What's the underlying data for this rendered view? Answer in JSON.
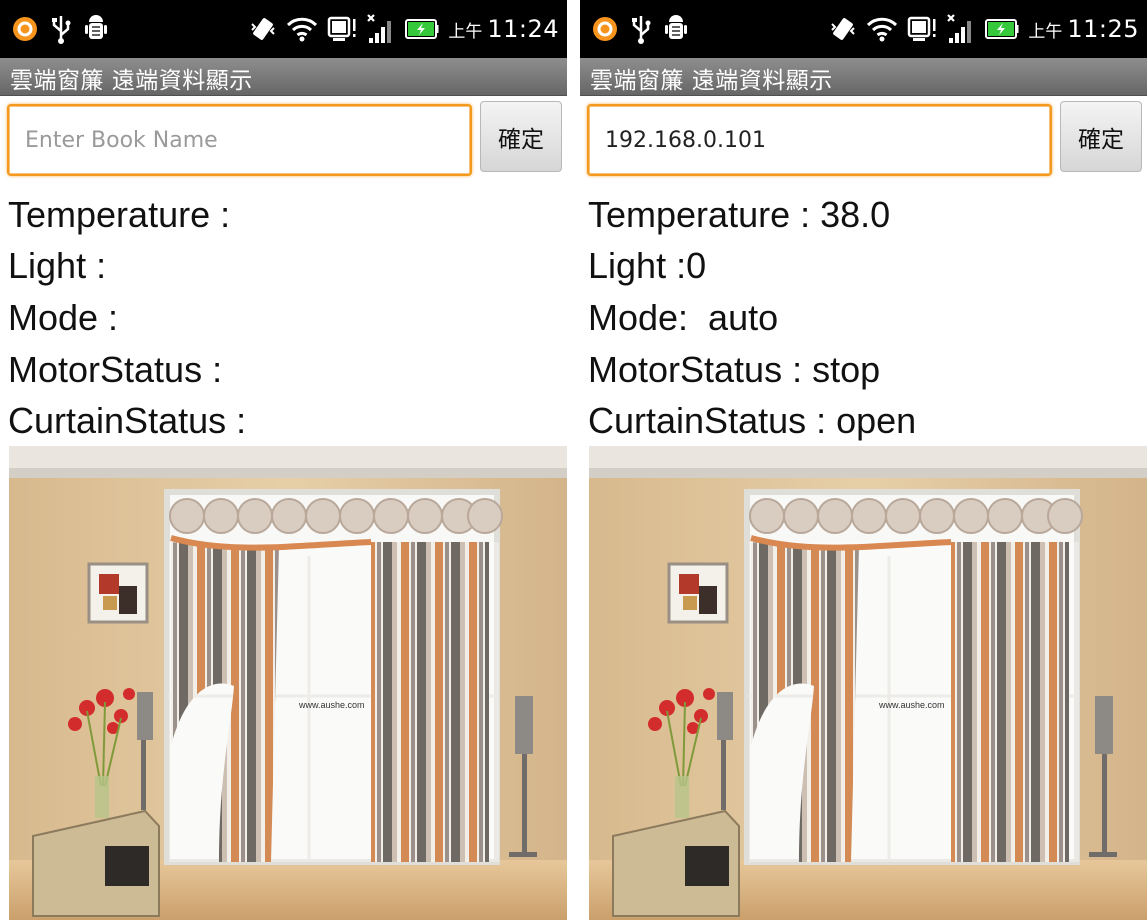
{
  "screens": [
    {
      "status_bar": {
        "ampm": "上午",
        "time": "11:24",
        "icons": [
          "orange-app-icon",
          "usb-icon",
          "android-debug-icon",
          "vibrate-icon",
          "wifi-icon",
          "sim-card-icon",
          "signal-icon",
          "battery-charging-icon"
        ]
      },
      "title": "雲端窗簾 遠端資料顯示",
      "input": {
        "value": "",
        "placeholder": "Enter Book Name"
      },
      "button_label": "確定",
      "info": {
        "temperature": "Temperature :",
        "light": "Light :",
        "mode": "Mode :",
        "motor_status": "MotorStatus :",
        "curtain_status": "CurtainStatus :"
      },
      "picture": {
        "watermark": "www.aushe.com"
      }
    },
    {
      "status_bar": {
        "ampm": "上午",
        "time": "11:25",
        "icons": [
          "orange-app-icon",
          "usb-icon",
          "android-debug-icon",
          "vibrate-icon",
          "wifi-icon",
          "sim-card-icon",
          "signal-icon",
          "battery-charging-icon"
        ]
      },
      "title": "雲端窗簾 遠端資料顯示",
      "input": {
        "value": "192.168.0.101",
        "placeholder": "Enter Book Name"
      },
      "button_label": "確定",
      "info": {
        "temperature": "Temperature : 38.0",
        "light": "Light :0",
        "mode": "Mode:  auto",
        "motor_status": "MotorStatus : stop",
        "curtain_status": "CurtainStatus : open"
      },
      "picture": {
        "watermark": "www.aushe.com"
      }
    }
  ],
  "colors": {
    "status_bar": "#000000",
    "title_bar": "#777777",
    "input_focus_border": "#f39a1e",
    "text": "#111111"
  }
}
